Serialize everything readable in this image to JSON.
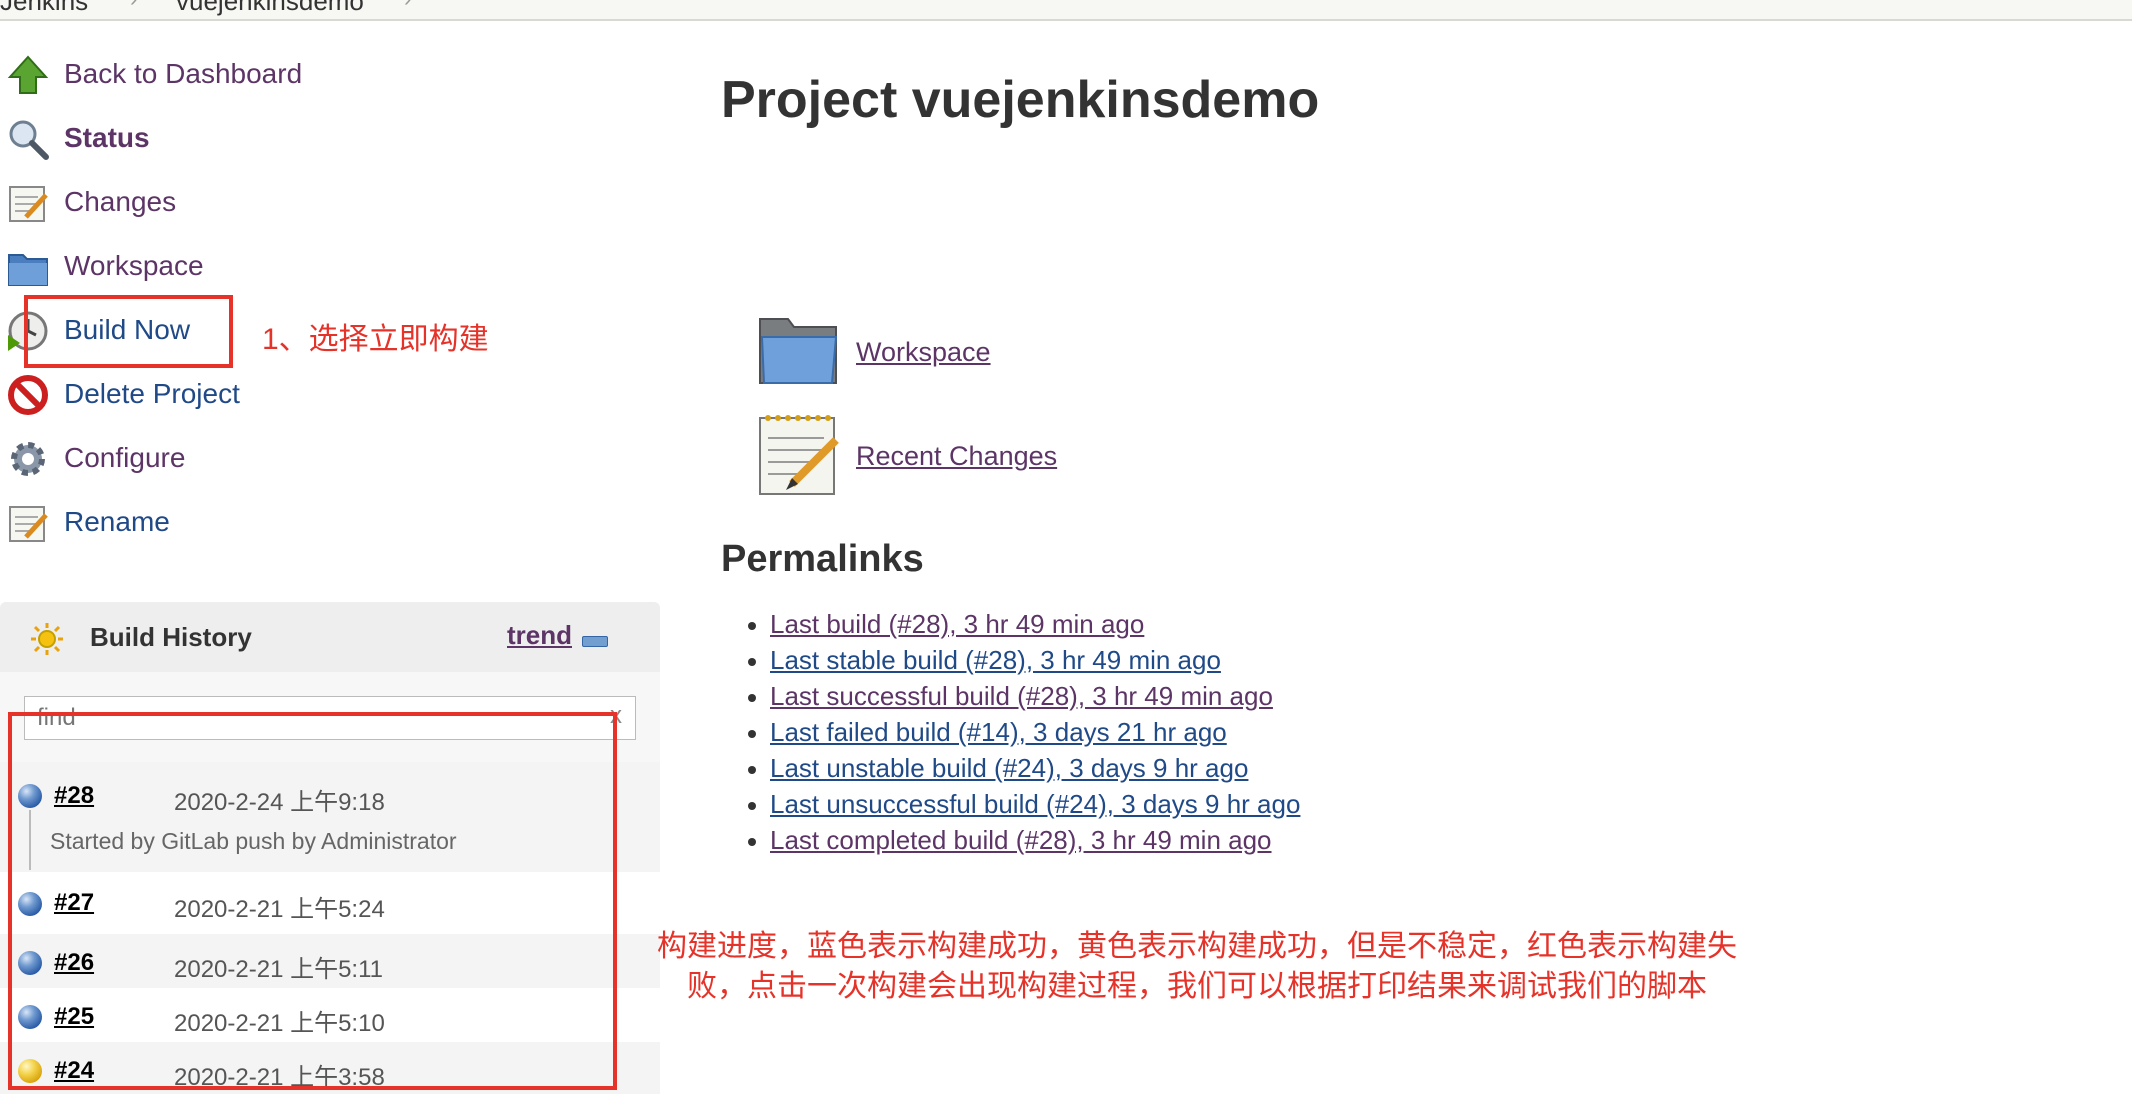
{
  "breadcrumb": {
    "items": [
      "Jenkins",
      "vuejenkinsdemo"
    ]
  },
  "sidebar": {
    "tasks": [
      {
        "label": "Back to Dashboard",
        "icon": "up-arrow-icon"
      },
      {
        "label": "Status",
        "icon": "magnifier-icon"
      },
      {
        "label": "Changes",
        "icon": "notepad-icon"
      },
      {
        "label": "Workspace",
        "icon": "folder-icon"
      },
      {
        "label": "Build Now",
        "icon": "clock-icon"
      },
      {
        "label": "Delete Project",
        "icon": "no-entry-icon"
      },
      {
        "label": "Configure",
        "icon": "gear-icon"
      },
      {
        "label": "Rename",
        "icon": "notepad-icon"
      }
    ]
  },
  "annotations": {
    "step1": "1、选择立即构建",
    "progress_line1": "构建进度，蓝色表示构建成功，黄色表示构建成功，但是不稳定，红色表示构建失",
    "progress_line2": "败，点击一次构建会出现构建过程，我们可以根据打印结果来调试我们的脚本",
    "color": "#e5332a"
  },
  "build_history": {
    "title": "Build History",
    "trend_label": "trend",
    "search_placeholder": "find",
    "search_clear": "x",
    "builds": [
      {
        "number": "#28",
        "date": "2020-2-24 上午9:18",
        "status": "blue",
        "cause": "Started by GitLab push by Administrator"
      },
      {
        "number": "#27",
        "date": "2020-2-21 上午5:24",
        "status": "blue"
      },
      {
        "number": "#26",
        "date": "2020-2-21 上午5:11",
        "status": "blue"
      },
      {
        "number": "#25",
        "date": "2020-2-21 上午5:10",
        "status": "blue"
      },
      {
        "number": "#24",
        "date": "2020-2-21 上午3:58",
        "status": "yellow"
      }
    ]
  },
  "main": {
    "title": "Project vuejenkinsdemo",
    "workspace_link": "Workspace",
    "recent_changes_link": "Recent Changes",
    "permalinks_heading": "Permalinks",
    "permalinks": [
      "Last build (#28), 3 hr 49 min ago",
      "Last stable build (#28), 3 hr 49 min ago",
      "Last successful build (#28), 3 hr 49 min ago",
      "Last failed build (#14), 3 days 21 hr ago",
      "Last unstable build (#24), 3 days 9 hr ago",
      "Last unsuccessful build (#24), 3 days 9 hr ago",
      "Last completed build (#28), 3 hr 49 min ago"
    ]
  },
  "colors": {
    "link": "#204a87",
    "visited": "#5c3566",
    "success": "#3465a4",
    "unstable": "#edd400"
  }
}
